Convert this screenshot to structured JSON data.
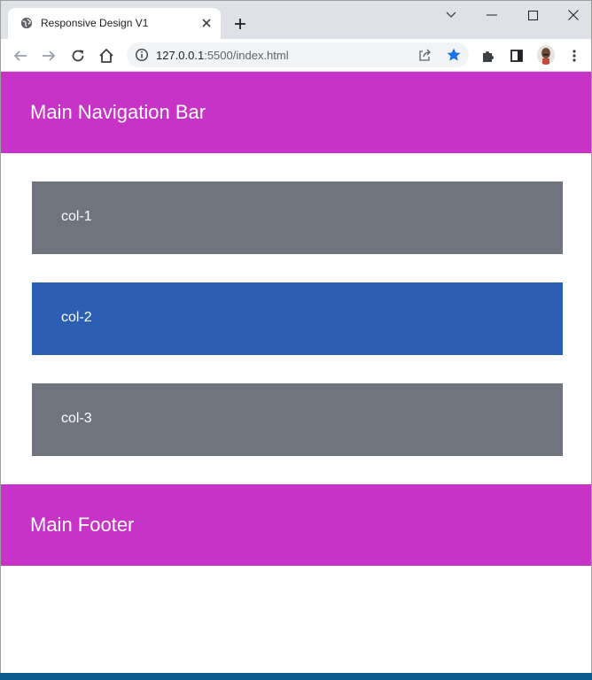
{
  "browser": {
    "tab_title": "Responsive Design V1",
    "url_host": "127.0.0.1",
    "url_rest": ":5500/index.html",
    "bookmarked_color": "#1a73e8"
  },
  "page": {
    "navbar_title": "Main Navigation Bar",
    "columns": [
      {
        "label": "col-1",
        "color": "#6f747e"
      },
      {
        "label": "col-2",
        "color": "#2c5fb3"
      },
      {
        "label": "col-3",
        "color": "#6f747e"
      }
    ],
    "footer_title": "Main Footer",
    "accent_color": "#c733c7"
  }
}
